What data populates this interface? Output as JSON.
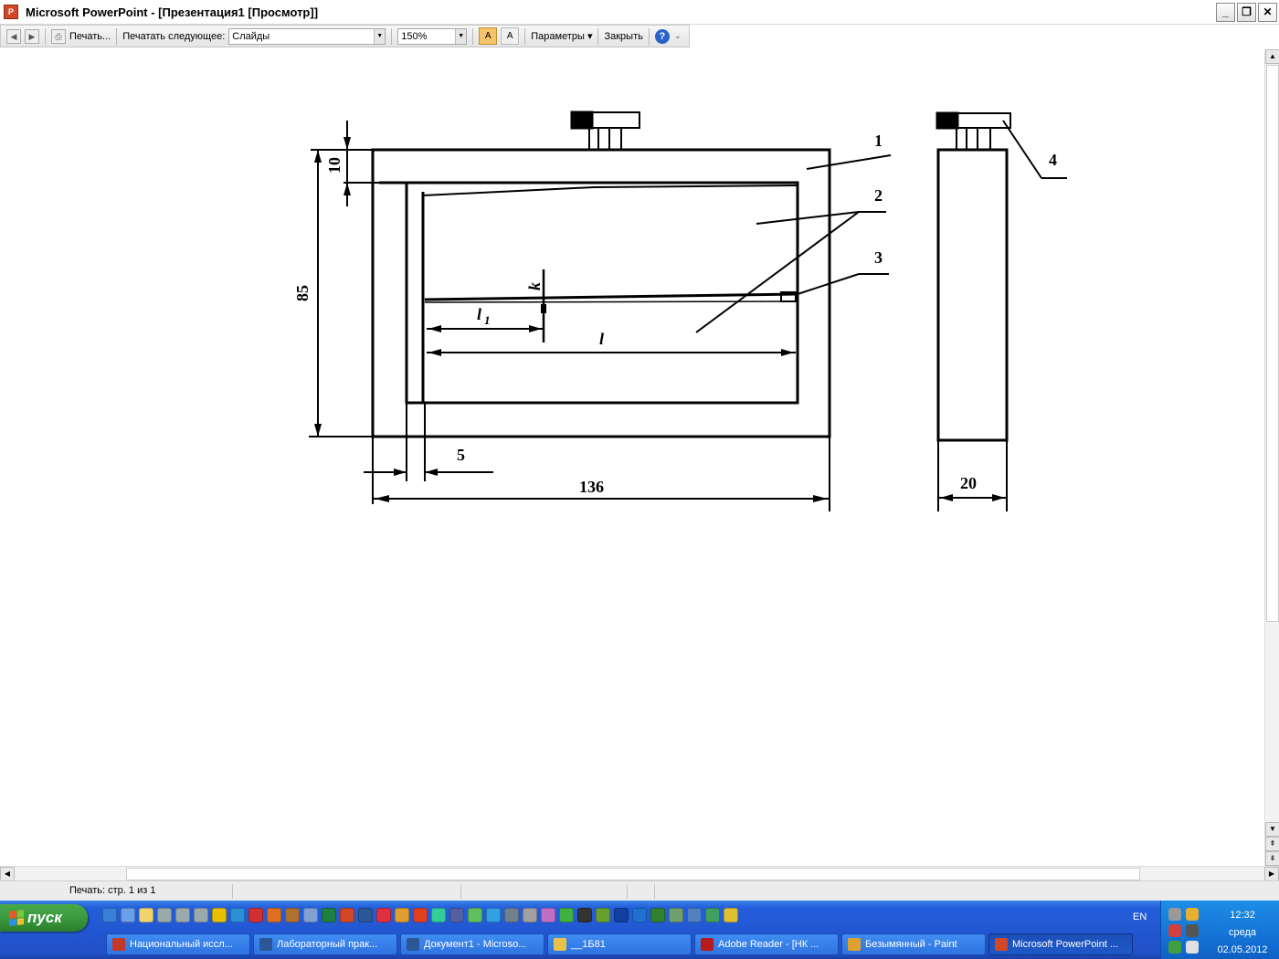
{
  "window": {
    "title": "Microsoft PowerPoint - [Презентация1 [Просмотр]]"
  },
  "toolbar": {
    "print_label": "Печать...",
    "print_what_label": "Печатать следующее:",
    "print_what_value": "Слайды",
    "zoom_value": "150%",
    "options_label": "Параметры",
    "close_label": "Закрыть"
  },
  "drawing": {
    "labels": {
      "part1": "1",
      "part2": "2",
      "part3": "3",
      "part4": "4",
      "part5": "5",
      "dim_10": "10",
      "dim_85": "85",
      "dim_136": "136",
      "dim_20": "20",
      "k": "k",
      "l": "l",
      "l1": "l",
      "l1_sub": "1"
    }
  },
  "status": {
    "page_text": "Печать: стр. 1 из 1"
  },
  "taskbar": {
    "start_label": "пуск",
    "lang": "EN",
    "tasks": [
      {
        "label": "Национальный иссл...",
        "icon_color": "#c0392b"
      },
      {
        "label": "Лабораторный прак...",
        "icon_color": "#2b5797"
      },
      {
        "label": "Документ1 - Microso...",
        "icon_color": "#2b5797"
      },
      {
        "label": "__1Б81",
        "icon_color": "#e8c24a"
      },
      {
        "label": "Adobe Reader - [НК ...",
        "icon_color": "#b71c1c"
      },
      {
        "label": "Безымянный - Paint",
        "icon_color": "#e0a030"
      },
      {
        "label": "Microsoft PowerPoint ...",
        "icon_color": "#d24726"
      }
    ],
    "clock": {
      "time": "12:32",
      "day": "среда",
      "date": "02.05.2012"
    }
  }
}
